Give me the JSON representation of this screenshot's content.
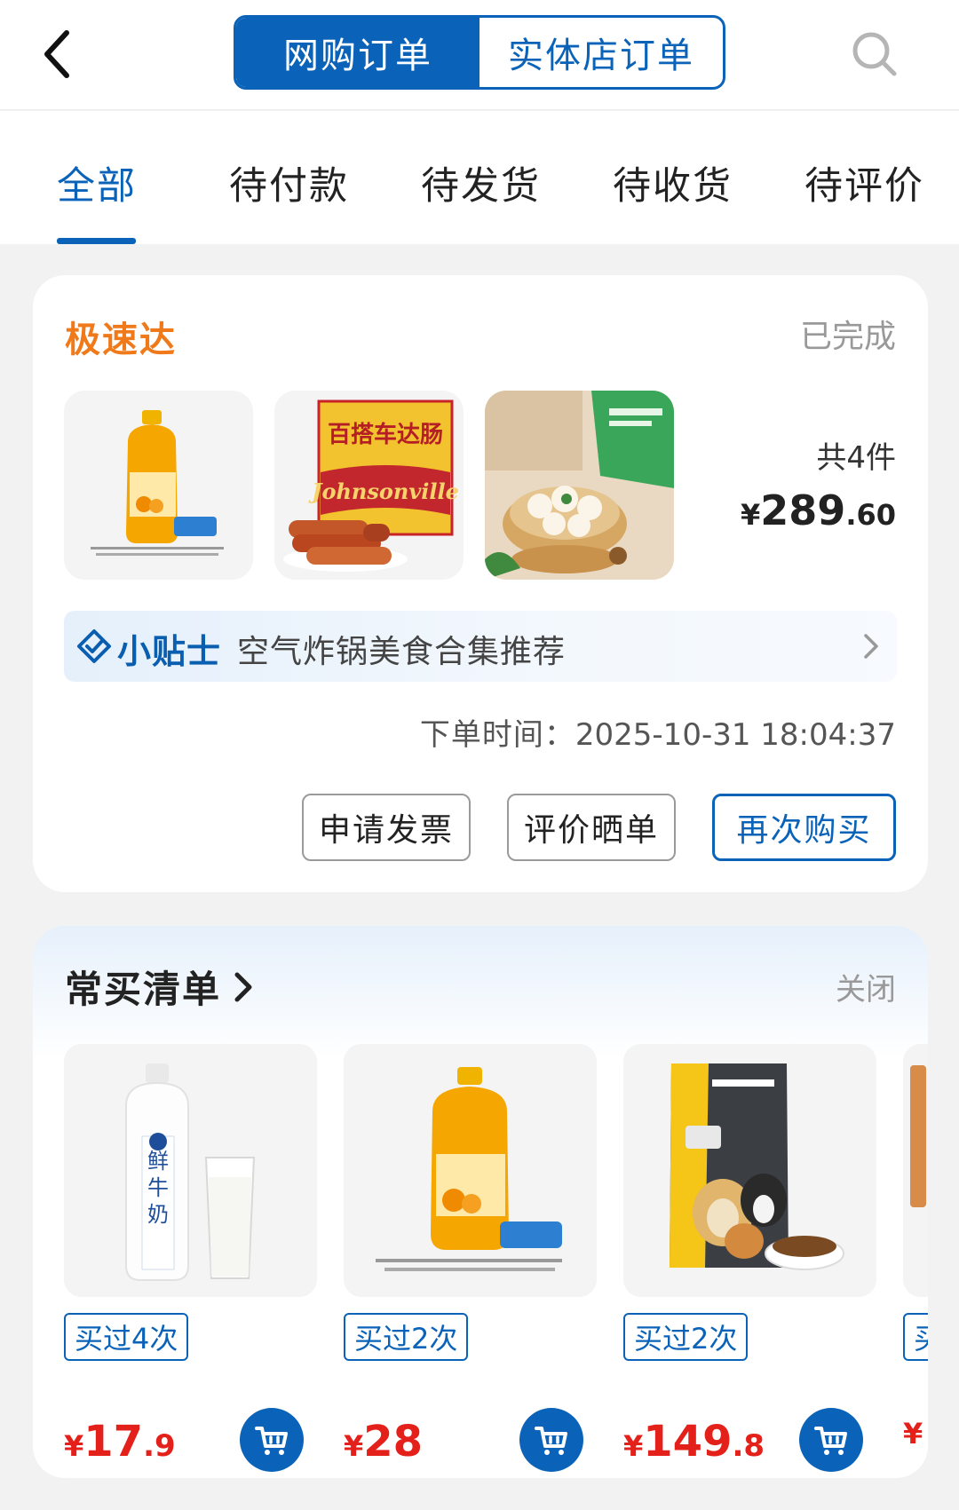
{
  "header": {
    "back_icon": "chevron-left-icon",
    "tabs": [
      {
        "label": "网购订单",
        "active": true
      },
      {
        "label": "实体店订单",
        "active": false
      }
    ],
    "search_icon": "search-icon"
  },
  "status_tabs": [
    {
      "label": "全部",
      "active": true
    },
    {
      "label": "待付款",
      "active": false
    },
    {
      "label": "待发货",
      "active": false
    },
    {
      "label": "待收货",
      "active": false
    },
    {
      "label": "待评价",
      "active": false
    }
  ],
  "order": {
    "delivery_type": "极速达",
    "status": "已完成",
    "item_count": "共4件",
    "total": {
      "currency": "¥",
      "integer": "289",
      "decimal": ".60"
    },
    "tip": {
      "title": "小贴士",
      "text": "空气炸锅美食合集推荐"
    },
    "time_label": "下单时间：",
    "time_value": "2025-10-31 18:04:37",
    "actions": {
      "invoice": "申请发票",
      "review": "评价晒单",
      "rebuy": "再次购买"
    },
    "thumbnail_labels": {
      "sausage_top": "百搭车达肠",
      "sausage_brand": "Johnsonville"
    }
  },
  "frequent": {
    "title": "常买清单",
    "close": "关闭",
    "products": [
      {
        "image": "fresh-milk",
        "label_text": "鲜牛奶",
        "bought": "买过4次",
        "price": {
          "currency": "¥",
          "integer": "17",
          "decimal": ".9"
        }
      },
      {
        "image": "orange-juice",
        "bought": "买过2次",
        "price": {
          "currency": "¥",
          "integer": "28",
          "decimal": ""
        }
      },
      {
        "image": "dog-food",
        "bought": "买过2次",
        "price": {
          "currency": "¥",
          "integer": "149",
          "decimal": ".8"
        }
      },
      {
        "image": "partial-product",
        "bought": "买",
        "price": {
          "currency": "¥",
          "integer": "",
          "decimal": ""
        }
      }
    ]
  },
  "colors": {
    "brand_blue": "#0a63b8",
    "accent_orange": "#f07a1a",
    "price_red": "#e4201b",
    "background": "#f2f2f2"
  }
}
